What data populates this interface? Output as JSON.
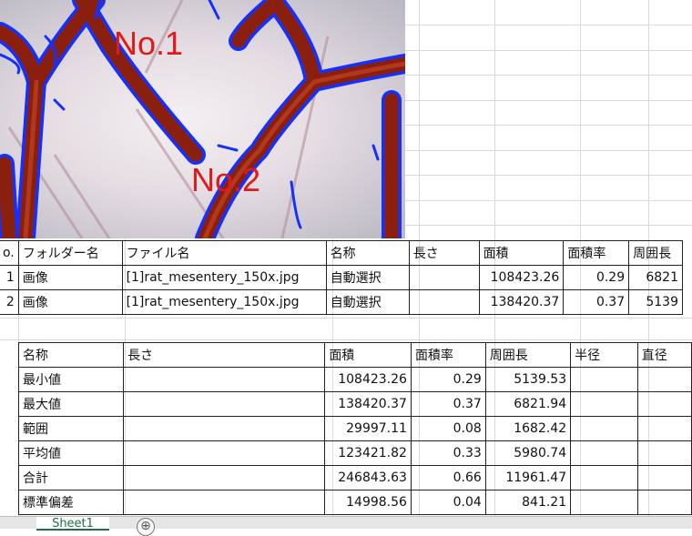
{
  "image": {
    "labels": [
      "No.1",
      "No.2"
    ],
    "colors": {
      "vessel": "#8a1f0e",
      "outline": "#1430ff",
      "label": "#e01a1a"
    }
  },
  "table1": {
    "headers": [
      "o.",
      "フォルダー名",
      "ファイル名",
      "名称",
      "長さ",
      "面積",
      "面積率",
      "周囲長"
    ],
    "rows": [
      [
        "1",
        "画像",
        "[1]rat_mesentery_150x.jpg",
        "自動選択",
        "",
        "108423.26",
        "0.29",
        "6821"
      ],
      [
        "2",
        "画像",
        "[1]rat_mesentery_150x.jpg",
        "自動選択",
        "",
        "138420.37",
        "0.37",
        "5139"
      ]
    ]
  },
  "table2": {
    "headers": [
      "名称",
      "長さ",
      "面積",
      "面積率",
      "周囲長",
      "半径",
      "直径"
    ],
    "rows": [
      [
        "最小値",
        "",
        "108423.26",
        "0.29",
        "5139.53",
        "",
        ""
      ],
      [
        "最大値",
        "",
        "138420.37",
        "0.37",
        "6821.94",
        "",
        ""
      ],
      [
        "範囲",
        "",
        "29997.11",
        "0.08",
        "1682.42",
        "",
        ""
      ],
      [
        "平均値",
        "",
        "123421.82",
        "0.33",
        "5980.74",
        "",
        ""
      ],
      [
        "合計",
        "",
        "246843.63",
        "0.66",
        "11961.47",
        "",
        ""
      ],
      [
        "標準偏差",
        "",
        "14998.56",
        "0.04",
        "841.21",
        "",
        ""
      ]
    ]
  },
  "sheet_tabs": {
    "active": "Sheet1",
    "add": "⊕"
  }
}
